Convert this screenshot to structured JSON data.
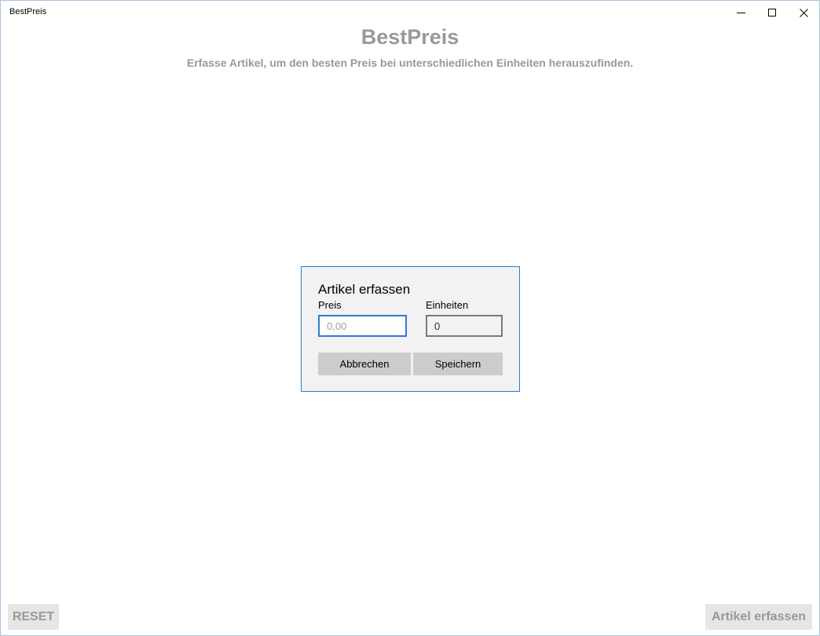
{
  "window": {
    "title": "BestPreis",
    "controls": {
      "minimize_icon": "minimize-icon",
      "maximize_icon": "maximize-icon",
      "close_icon": "close-icon"
    }
  },
  "header": {
    "title": "BestPreis",
    "subtitle": "Erfasse Artikel, um den besten Preis bei unterschiedlichen Einheiten herauszufinden."
  },
  "dialog": {
    "title": "Artikel erfassen",
    "price": {
      "label": "Preis",
      "value": "",
      "placeholder": "0,00"
    },
    "units": {
      "label": "Einheiten",
      "value": "0"
    },
    "cancel_label": "Abbrechen",
    "save_label": "Speichern"
  },
  "footer": {
    "reset_label": "RESET",
    "add_label": "Artikel erfassen"
  },
  "colors": {
    "accent": "#2b7cd3",
    "muted_text": "#999999",
    "dialog_background": "#f2f2f2",
    "button_background": "#cccccc"
  }
}
